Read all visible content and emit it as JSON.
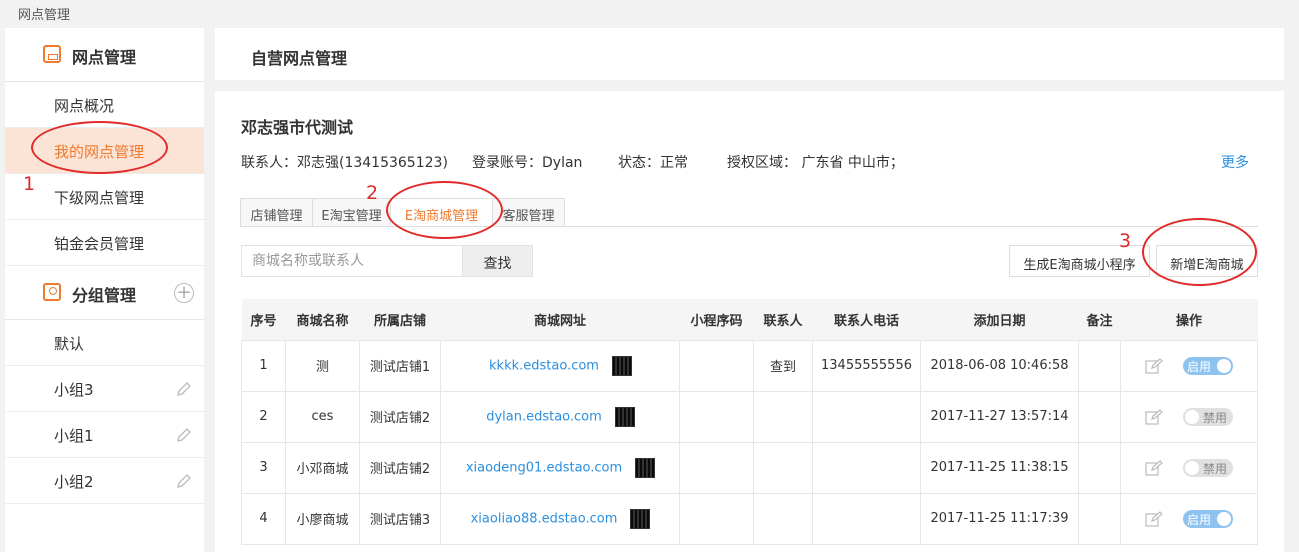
{
  "breadcrumb": "网点管理",
  "sidebar": {
    "section1": "网点管理",
    "items": [
      "网点概况",
      "我的网点管理",
      "下级网点管理",
      "铂金会员管理"
    ],
    "section2": "分组管理",
    "groups": [
      "默认",
      "小组3",
      "小组1",
      "小组2"
    ]
  },
  "header": {
    "title": "自营网点管理"
  },
  "org": {
    "name": "邓志强市代测试",
    "contact": "联系人：邓志强(13415365123)",
    "account": "登录账号：Dylan",
    "status": "状态：正常",
    "region": "授权区域： 广东省 中山市；",
    "more": "更多"
  },
  "tabs": [
    "店铺管理",
    "E淘宝管理",
    "E淘商城管理",
    "客服管理"
  ],
  "search": {
    "placeholder": "商城名称或联系人",
    "button": "查找"
  },
  "actions": {
    "generate": "生成E淘商城小程序",
    "add": "新增E淘商城"
  },
  "table": {
    "headers": [
      "序号",
      "商城名称",
      "所属店铺",
      "商城网址",
      "小程序码",
      "联系人",
      "联系人电话",
      "添加日期",
      "备注",
      "操作"
    ],
    "rows": [
      {
        "no": "1",
        "name": "测",
        "shop": "测试店铺1",
        "url": "kkkk.edstao.com",
        "contact": "查到",
        "phone": "13455555556",
        "date": "2018-06-08 10:46:58",
        "note": "",
        "toggle": "启用",
        "enabled": true
      },
      {
        "no": "2",
        "name": "ces",
        "shop": "测试店铺2",
        "url": "dylan.edstao.com",
        "contact": "",
        "phone": "",
        "date": "2017-11-27 13:57:14",
        "note": "",
        "toggle": "禁用",
        "enabled": false
      },
      {
        "no": "3",
        "name": "小邓商城",
        "shop": "测试店铺2",
        "url": "xiaodeng01.edstao.com",
        "contact": "",
        "phone": "",
        "date": "2017-11-25 11:38:15",
        "note": "",
        "toggle": "禁用",
        "enabled": false
      },
      {
        "no": "4",
        "name": "小廖商城",
        "shop": "测试店铺3",
        "url": "xiaoliao88.edstao.com",
        "contact": "",
        "phone": "",
        "date": "2017-11-25 11:17:39",
        "note": "",
        "toggle": "启用",
        "enabled": true
      }
    ]
  },
  "annotations": [
    "1",
    "2",
    "3"
  ],
  "colors": {
    "accent": "#f07a2e",
    "link": "#2a8fe0",
    "annotation": "#e12b2b"
  }
}
